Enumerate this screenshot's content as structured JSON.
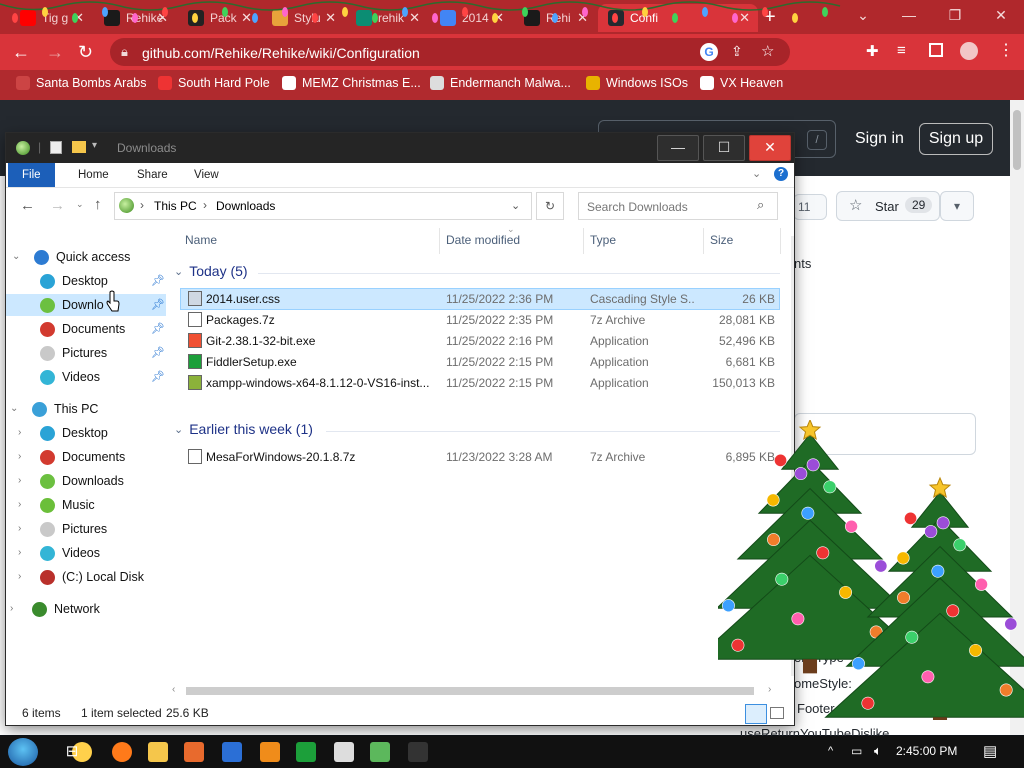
{
  "browser": {
    "tabs": [
      {
        "label": "Tig g",
        "favicon": "youtube-icon",
        "color": "#ff0000"
      },
      {
        "label": "Rehike",
        "favicon": "rehike-icon",
        "color": "#1a1a1a"
      },
      {
        "label": "Pack",
        "favicon": "cloud-icon",
        "color": "#222"
      },
      {
        "label": "Stylu",
        "favicon": "stylus-icon",
        "color": "#e8a33b"
      },
      {
        "label": "rehik",
        "favicon": "s-icon",
        "color": "#0b8d73"
      },
      {
        "label": "2014",
        "favicon": "google-icon",
        "color": "#4285f4"
      },
      {
        "label": "Rehi",
        "favicon": "rehike-icon",
        "color": "#1a1a1a"
      },
      {
        "label": "Confi",
        "favicon": "github-icon",
        "color": "#24292f"
      }
    ],
    "url": "github.com/Rehike/Rehike/wiki/Configuration",
    "bookmarks": [
      {
        "label": "Santa Bombs Arabs",
        "icon": "bookmark-icon"
      },
      {
        "label": "South Hard Pole",
        "icon": "snowflake-icon"
      },
      {
        "label": "MEMZ Christmas E...",
        "icon": "document-icon"
      },
      {
        "label": "Endermanch Malwa...",
        "icon": "raccoon-icon"
      },
      {
        "label": "Windows ISOs",
        "icon": "trophy-icon"
      },
      {
        "label": "VX Heaven",
        "icon": "biohazard-icon"
      }
    ]
  },
  "github": {
    "sign_in": "Sign in",
    "sign_up": "Sign up",
    "slash": "/",
    "fork_count": "11",
    "star_label": "Star",
    "star_count": "29",
    "side_fragment": "nts",
    "behind_text": [
      "enuType",
      "omeStyle:",
      "Footer",
      "useReturnYouTubeDislike"
    ]
  },
  "explorer": {
    "title": "Downloads",
    "ribbon_tabs": [
      "File",
      "Home",
      "Share",
      "View"
    ],
    "breadcrumb": [
      "This PC",
      "Downloads"
    ],
    "search_placeholder": "Search Downloads",
    "nav": {
      "quick_access": "Quick access",
      "quick_items": [
        "Desktop",
        "Downlo",
        "Documents",
        "Pictures",
        "Videos"
      ],
      "this_pc": "This PC",
      "pc_items": [
        "Desktop",
        "Documents",
        "Downloads",
        "Music",
        "Pictures",
        "Videos",
        "(C:) Local Disk"
      ],
      "network": "Network"
    },
    "columns": [
      "Name",
      "Date modified",
      "Type",
      "Size"
    ],
    "groups": [
      {
        "label": "Today (5)",
        "files": [
          {
            "name": "2014.user.css",
            "date": "11/25/2022 2:36 PM",
            "type": "Cascading Style S...",
            "size": "26 KB",
            "icon": "css-file-icon"
          },
          {
            "name": "Packages.7z",
            "date": "11/25/2022 2:35 PM",
            "type": "7z Archive",
            "size": "28,081 KB",
            "icon": "7z-archive-icon"
          },
          {
            "name": "Git-2.38.1-32-bit.exe",
            "date": "11/25/2022 2:16 PM",
            "type": "Application",
            "size": "52,496 KB",
            "icon": "git-icon"
          },
          {
            "name": "FiddlerSetup.exe",
            "date": "11/25/2022 2:15 PM",
            "type": "Application",
            "size": "6,681 KB",
            "icon": "fiddler-icon"
          },
          {
            "name": "xampp-windows-x64-8.1.12-0-VS16-inst...",
            "date": "11/25/2022 2:15 PM",
            "type": "Application",
            "size": "150,013 KB",
            "icon": "xampp-icon"
          }
        ]
      },
      {
        "label": "Earlier this week (1)",
        "files": [
          {
            "name": "MesaForWindows-20.1.8.7z",
            "date": "11/23/2022 3:28 AM",
            "type": "7z Archive",
            "size": "6,895 KB",
            "icon": "7z-archive-icon"
          }
        ]
      }
    ],
    "status": {
      "count": "6 items",
      "selected": "1 item selected",
      "size": "25.6 KB"
    }
  },
  "taskbar": {
    "time": "2:45:00 PM",
    "apps": [
      "chrome-icon",
      "firefox-icon",
      "file-explorer-icon",
      "sublime-icon",
      "powershell-icon",
      "search-magnifier-icon",
      "fiddler-icon",
      "7zip-icon",
      "notepadpp-icon",
      "cmd-icon"
    ]
  },
  "colors": {
    "chrome_red": "#d9343a",
    "tab_strip": "#b0282c",
    "selection": "#cce8ff",
    "file_tab": "#1c5fb9",
    "github_header": "#24292f"
  }
}
